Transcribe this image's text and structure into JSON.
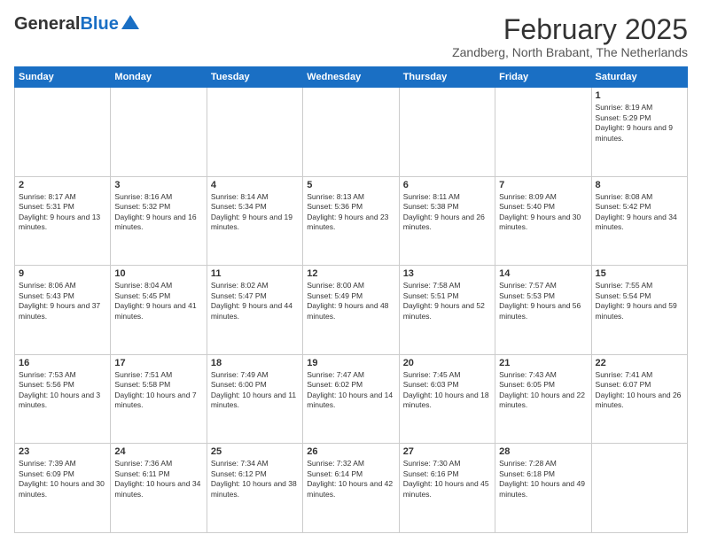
{
  "logo": {
    "general": "General",
    "blue": "Blue"
  },
  "header": {
    "month": "February 2025",
    "location": "Zandberg, North Brabant, The Netherlands"
  },
  "weekdays": [
    "Sunday",
    "Monday",
    "Tuesday",
    "Wednesday",
    "Thursday",
    "Friday",
    "Saturday"
  ],
  "weeks": [
    [
      {
        "day": "",
        "info": ""
      },
      {
        "day": "",
        "info": ""
      },
      {
        "day": "",
        "info": ""
      },
      {
        "day": "",
        "info": ""
      },
      {
        "day": "",
        "info": ""
      },
      {
        "day": "",
        "info": ""
      },
      {
        "day": "1",
        "info": "Sunrise: 8:19 AM\nSunset: 5:29 PM\nDaylight: 9 hours and 9 minutes."
      }
    ],
    [
      {
        "day": "2",
        "info": "Sunrise: 8:17 AM\nSunset: 5:31 PM\nDaylight: 9 hours and 13 minutes."
      },
      {
        "day": "3",
        "info": "Sunrise: 8:16 AM\nSunset: 5:32 PM\nDaylight: 9 hours and 16 minutes."
      },
      {
        "day": "4",
        "info": "Sunrise: 8:14 AM\nSunset: 5:34 PM\nDaylight: 9 hours and 19 minutes."
      },
      {
        "day": "5",
        "info": "Sunrise: 8:13 AM\nSunset: 5:36 PM\nDaylight: 9 hours and 23 minutes."
      },
      {
        "day": "6",
        "info": "Sunrise: 8:11 AM\nSunset: 5:38 PM\nDaylight: 9 hours and 26 minutes."
      },
      {
        "day": "7",
        "info": "Sunrise: 8:09 AM\nSunset: 5:40 PM\nDaylight: 9 hours and 30 minutes."
      },
      {
        "day": "8",
        "info": "Sunrise: 8:08 AM\nSunset: 5:42 PM\nDaylight: 9 hours and 34 minutes."
      }
    ],
    [
      {
        "day": "9",
        "info": "Sunrise: 8:06 AM\nSunset: 5:43 PM\nDaylight: 9 hours and 37 minutes."
      },
      {
        "day": "10",
        "info": "Sunrise: 8:04 AM\nSunset: 5:45 PM\nDaylight: 9 hours and 41 minutes."
      },
      {
        "day": "11",
        "info": "Sunrise: 8:02 AM\nSunset: 5:47 PM\nDaylight: 9 hours and 44 minutes."
      },
      {
        "day": "12",
        "info": "Sunrise: 8:00 AM\nSunset: 5:49 PM\nDaylight: 9 hours and 48 minutes."
      },
      {
        "day": "13",
        "info": "Sunrise: 7:58 AM\nSunset: 5:51 PM\nDaylight: 9 hours and 52 minutes."
      },
      {
        "day": "14",
        "info": "Sunrise: 7:57 AM\nSunset: 5:53 PM\nDaylight: 9 hours and 56 minutes."
      },
      {
        "day": "15",
        "info": "Sunrise: 7:55 AM\nSunset: 5:54 PM\nDaylight: 9 hours and 59 minutes."
      }
    ],
    [
      {
        "day": "16",
        "info": "Sunrise: 7:53 AM\nSunset: 5:56 PM\nDaylight: 10 hours and 3 minutes."
      },
      {
        "day": "17",
        "info": "Sunrise: 7:51 AM\nSunset: 5:58 PM\nDaylight: 10 hours and 7 minutes."
      },
      {
        "day": "18",
        "info": "Sunrise: 7:49 AM\nSunset: 6:00 PM\nDaylight: 10 hours and 11 minutes."
      },
      {
        "day": "19",
        "info": "Sunrise: 7:47 AM\nSunset: 6:02 PM\nDaylight: 10 hours and 14 minutes."
      },
      {
        "day": "20",
        "info": "Sunrise: 7:45 AM\nSunset: 6:03 PM\nDaylight: 10 hours and 18 minutes."
      },
      {
        "day": "21",
        "info": "Sunrise: 7:43 AM\nSunset: 6:05 PM\nDaylight: 10 hours and 22 minutes."
      },
      {
        "day": "22",
        "info": "Sunrise: 7:41 AM\nSunset: 6:07 PM\nDaylight: 10 hours and 26 minutes."
      }
    ],
    [
      {
        "day": "23",
        "info": "Sunrise: 7:39 AM\nSunset: 6:09 PM\nDaylight: 10 hours and 30 minutes."
      },
      {
        "day": "24",
        "info": "Sunrise: 7:36 AM\nSunset: 6:11 PM\nDaylight: 10 hours and 34 minutes."
      },
      {
        "day": "25",
        "info": "Sunrise: 7:34 AM\nSunset: 6:12 PM\nDaylight: 10 hours and 38 minutes."
      },
      {
        "day": "26",
        "info": "Sunrise: 7:32 AM\nSunset: 6:14 PM\nDaylight: 10 hours and 42 minutes."
      },
      {
        "day": "27",
        "info": "Sunrise: 7:30 AM\nSunset: 6:16 PM\nDaylight: 10 hours and 45 minutes."
      },
      {
        "day": "28",
        "info": "Sunrise: 7:28 AM\nSunset: 6:18 PM\nDaylight: 10 hours and 49 minutes."
      },
      {
        "day": "",
        "info": ""
      }
    ]
  ]
}
